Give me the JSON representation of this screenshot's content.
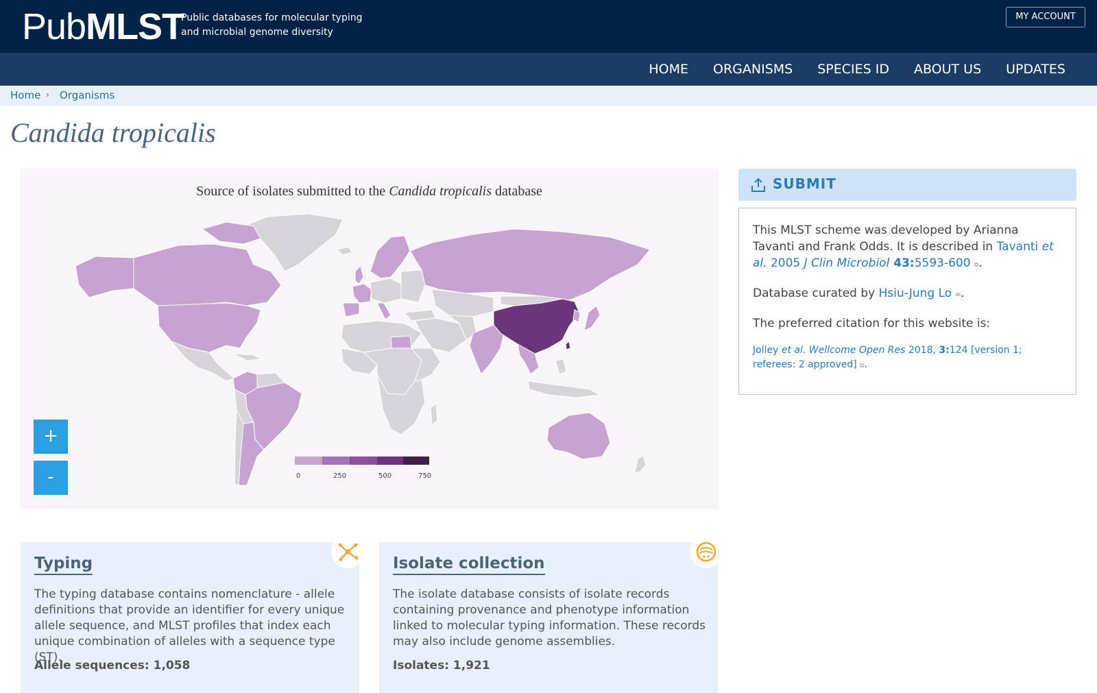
{
  "header": {
    "logo_light": "Pub",
    "logo_bold": "MLST",
    "tagline": "Public databases for molecular typing and microbial genome diversity",
    "account_button": "MY ACCOUNT"
  },
  "nav": {
    "items": [
      "HOME",
      "ORGANISMS",
      "SPECIES ID",
      "ABOUT US",
      "UPDATES"
    ]
  },
  "breadcrumb": {
    "home": "Home",
    "sep": "›",
    "organisms": "Organisms"
  },
  "page": {
    "title": "Candida tropicalis"
  },
  "map": {
    "title_prefix": "Source of isolates submitted to the ",
    "title_species": "Candida tropicalis",
    "title_suffix": " database",
    "zoom_in": "+",
    "zoom_out": "-",
    "legend_ticks": [
      "0",
      "250",
      "500",
      "750"
    ],
    "legend_colors": [
      "#c7a3d1",
      "#a874b8",
      "#8c4e9f",
      "#6a3579",
      "#3d1f47"
    ],
    "colors": {
      "no_data": "#d9d3dc",
      "low": "#c7a3d1",
      "high": "#6a3579"
    }
  },
  "submit": {
    "label": "SUBMIT",
    "icon": "upload-icon"
  },
  "info": {
    "developed_text": "This MLST scheme was developed by Arianna Tavanti and Frank Odds. It is described in ",
    "ref_author": "Tavanti",
    "ref_etal": " et al.",
    "ref_year": " 2005 ",
    "ref_journal": "J Clin Microbiol",
    "ref_volume": " 43:",
    "ref_pages": "5593-600",
    "ext_symbol": "⧉",
    "period": ".",
    "curated_text": "Database curated by ",
    "curator": "Hsiu-Jung Lo",
    "mail_symbol": "✉",
    "citation_intro": "The preferred citation for this website is:",
    "cite_author": "Jolley",
    "cite_etal": " et al.",
    "cite_journal": " Wellcome Open Res",
    "cite_year": " 2018, ",
    "cite_volume": "3:",
    "cite_rest": "124 [version 1; referees: 2 approved]"
  },
  "cards": {
    "typing": {
      "title": "Typing",
      "text": "The typing database contains nomenclature - allele definitions that provide an identifier for every unique allele sequence, and MLST profiles that index each unique combination of alleles with a sequence type (ST).",
      "stat": "Allele sequences: 1,058",
      "icon": "typing-network-icon"
    },
    "isolates": {
      "title": "Isolate collection",
      "text": "The isolate database consists of isolate records containing provenance and phenotype information linked to molecular typing information. These records may also include genome assemblies.",
      "stat": "Isolates: 1,921",
      "icon": "petri-dish-icon"
    }
  }
}
